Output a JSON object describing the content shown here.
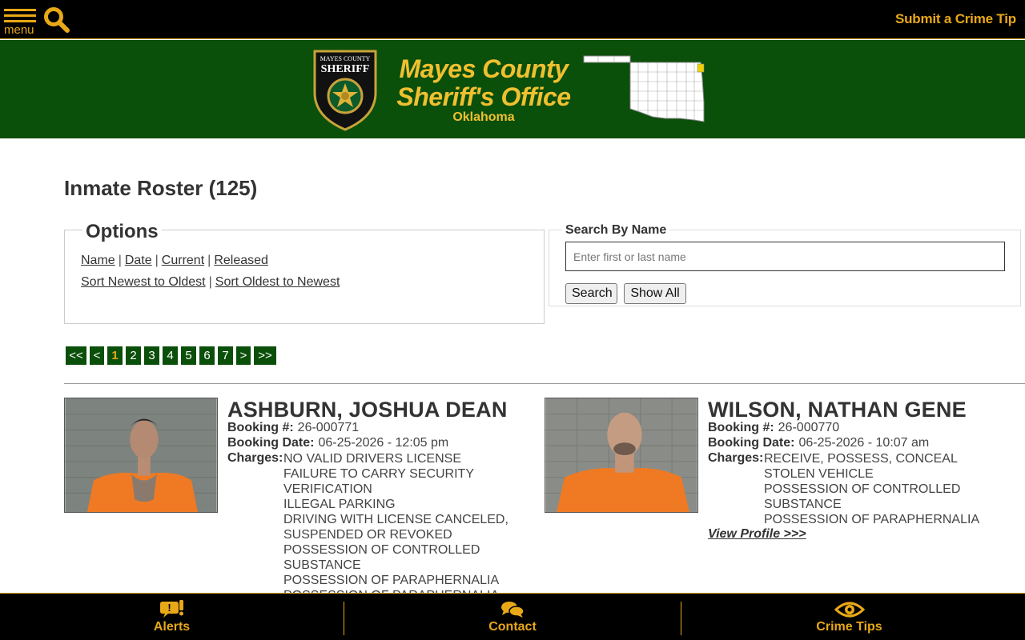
{
  "header": {
    "menu_label": "menu",
    "crime_tip_label": "Submit a Crime Tip"
  },
  "banner": {
    "badge_text": "MAYES COUNTY SHERIFF",
    "title_line1": "Mayes County",
    "title_line2": "Sheriff's Office",
    "subtitle": "Oklahoma"
  },
  "page": {
    "title": "Inmate Roster (125)"
  },
  "options": {
    "legend": "Options",
    "sort_fields": [
      "Name",
      "Date",
      "Current",
      "Released"
    ],
    "sort_orders": [
      "Sort Newest to Oldest",
      "Sort Oldest to Newest"
    ]
  },
  "search": {
    "legend": "Search By Name",
    "placeholder": "Enter first or last name",
    "value": "",
    "search_button": "Search",
    "show_all_button": "Show All"
  },
  "pagination": {
    "first": "<<",
    "prev": "<",
    "pages": [
      "1",
      "2",
      "3",
      "4",
      "5",
      "6",
      "7"
    ],
    "current": "1",
    "next": ">",
    "last": ">>"
  },
  "labels": {
    "booking_number": "Booking #:",
    "booking_date": "Booking Date:",
    "charges": "Charges:"
  },
  "inmates": [
    {
      "name": "ASHBURN, JOSHUA DEAN",
      "booking_number": "26-000771",
      "booking_date": "06-25-2026 - 12:05 pm",
      "charges": [
        "NO VALID DRIVERS LICENSE",
        "FAILURE TO CARRY SECURITY VERIFICATION",
        "ILLEGAL PARKING",
        "DRIVING WITH LICENSE CANCELED, SUSPENDED OR REVOKED",
        "POSSESSION OF CONTROLLED SUBSTANCE",
        "POSSESSION OF PARAPHERNALIA",
        "POSSESSION OF PARAPHERNALIA"
      ]
    },
    {
      "name": "WILSON, NATHAN GENE",
      "booking_number": "26-000770",
      "booking_date": "06-25-2026 - 10:07 am",
      "charges": [
        "RECEIVE, POSSESS, CONCEAL STOLEN VEHICLE",
        "POSSESSION OF CONTROLLED SUBSTANCE",
        "POSSESSION OF PARAPHERNALIA"
      ],
      "view_profile_label": "View Profile >>>"
    }
  ],
  "bottom_nav": {
    "alerts": "Alerts",
    "contact": "Contact",
    "crime_tips": "Crime Tips"
  },
  "colors": {
    "gold": "#e8a817",
    "green": "#0a4f0a",
    "black": "#000000"
  }
}
